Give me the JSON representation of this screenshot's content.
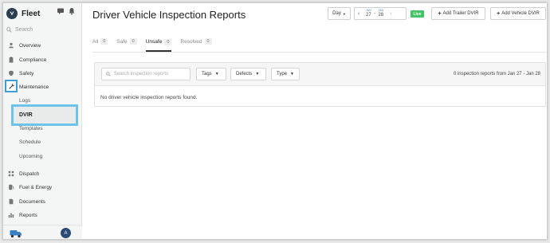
{
  "app": {
    "name": "Fleet"
  },
  "sidebar": {
    "search_label": "Search",
    "items": [
      {
        "label": "Overview",
        "icon": "person-icon"
      },
      {
        "label": "Compliance",
        "icon": "clipboard-icon"
      },
      {
        "label": "Safety",
        "icon": "shield-icon"
      },
      {
        "label": "Maintenance",
        "icon": "wrench-icon"
      },
      {
        "label": "Dispatch",
        "icon": "dispatch-icon"
      },
      {
        "label": "Fuel & Energy",
        "icon": "fuel-icon"
      },
      {
        "label": "Documents",
        "icon": "document-icon"
      },
      {
        "label": "Reports",
        "icon": "bar-chart-icon"
      }
    ],
    "maintenance_sub": [
      "Logs",
      "DVIR",
      "Templates",
      "Schedule",
      "Upcoming"
    ],
    "active_sub": "DVIR",
    "avatar_initial": "A"
  },
  "header": {
    "title": "Driver Vehicle Inspection Reports",
    "range_select": "Day",
    "date_start": {
      "month": "JAN",
      "day": "27"
    },
    "date_end": {
      "month": "JAN",
      "day": "28"
    },
    "live_label": "Live",
    "add_trailer_label": "Add Trailer DVIR",
    "add_vehicle_label": "Add Vehicle DVIR"
  },
  "tabs": [
    {
      "label": "All",
      "count": "0"
    },
    {
      "label": "Safe",
      "count": "0"
    },
    {
      "label": "Unsafe",
      "count": "0"
    },
    {
      "label": "Resolved",
      "count": "0"
    }
  ],
  "active_tab": "Unsafe",
  "filters": {
    "search_placeholder": "Search inspection reports",
    "tags_label": "Tags",
    "defects_label": "Defects",
    "type_label": "Type",
    "count_text": "0 inspection reports from Jan 27 - Jan 28"
  },
  "empty_message": "No driver vehicle inspection reports found.",
  "colors": {
    "accent": "#3a9fd8",
    "live": "#41c463",
    "highlight": "#6cc4ea"
  }
}
